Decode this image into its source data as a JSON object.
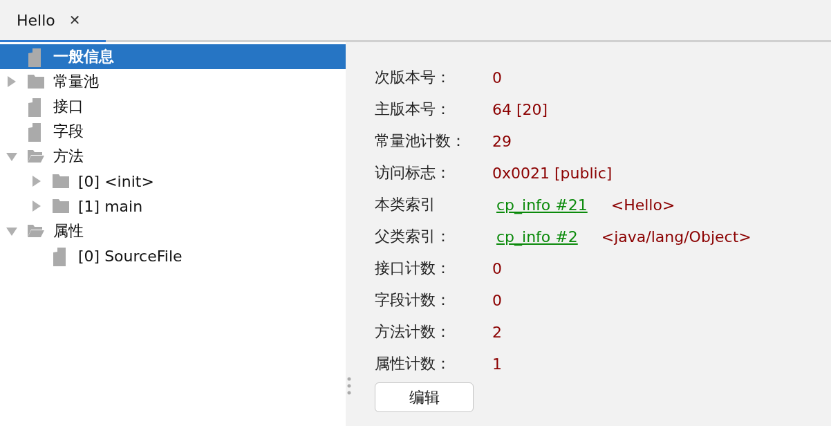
{
  "tabs": [
    {
      "label": "Hello",
      "selected": true,
      "close": "✕"
    }
  ],
  "tree": [
    {
      "kind": "file",
      "label": "一般信息",
      "selected": true
    },
    {
      "kind": "folder",
      "label": "常量池",
      "selected": false,
      "expanded": false
    },
    {
      "kind": "file",
      "label": "接口",
      "selected": false
    },
    {
      "kind": "file",
      "label": "字段",
      "selected": false
    },
    {
      "kind": "folder",
      "label": "方法",
      "selected": false,
      "expanded": true,
      "children": [
        {
          "kind": "folder",
          "label": "[0] <init>",
          "selected": false,
          "expanded": false
        },
        {
          "kind": "folder",
          "label": "[1] main",
          "selected": false,
          "expanded": false
        }
      ]
    },
    {
      "kind": "folder",
      "label": "属性",
      "selected": false,
      "expanded": true,
      "children": [
        {
          "kind": "file",
          "label": "[0] SourceFile",
          "selected": false
        }
      ]
    }
  ],
  "details": [
    {
      "label": "次版本号：",
      "value": "0"
    },
    {
      "label": "主版本号：",
      "value": "64 [20]"
    },
    {
      "label": "常量池计数：",
      "value": "29"
    },
    {
      "label": "访问标志：",
      "value": "0x0021 [public]"
    },
    {
      "label": "本类索引",
      "link": "cp_info #21",
      "value": "<Hello>"
    },
    {
      "label": "父类索引：",
      "link": "cp_info #2",
      "value": "<java/lang/Object>"
    },
    {
      "label": "接口计数：",
      "value": "0"
    },
    {
      "label": "字段计数：",
      "value": "0"
    },
    {
      "label": "方法计数：",
      "value": "2"
    },
    {
      "label": "属性计数：",
      "value": "1"
    }
  ],
  "edit_button": "编辑"
}
